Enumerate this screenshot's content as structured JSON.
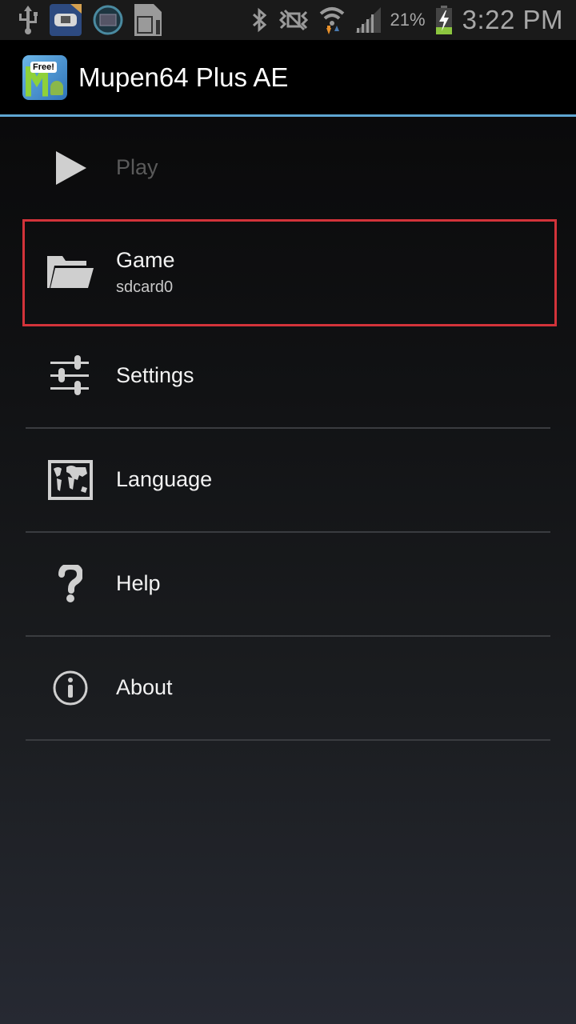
{
  "status_bar": {
    "left_icons": [
      "usb-icon",
      "gba-emulator-app-icon",
      "circle-app-icon",
      "sd-card-icon"
    ],
    "right_icons": [
      "bluetooth-icon",
      "vibrate-mute-icon",
      "wifi-icon",
      "signal-icon"
    ],
    "battery_percent": "21%",
    "battery_charging": true,
    "time": "3:22 PM"
  },
  "action_bar": {
    "app_icon": "mupen64-app-icon",
    "app_icon_badge": "Free!",
    "title": "Mupen64 Plus AE",
    "accent_color": "#5ea6d2"
  },
  "menu": {
    "items": [
      {
        "id": "play",
        "label": "Play",
        "icon": "play-icon",
        "enabled": false
      },
      {
        "id": "game",
        "label": "Game",
        "subtitle": "sdcard0",
        "icon": "folder-icon",
        "enabled": true,
        "highlighted": true
      },
      {
        "id": "settings",
        "label": "Settings",
        "icon": "sliders-icon",
        "enabled": true
      },
      {
        "id": "language",
        "label": "Language",
        "icon": "world-map-icon",
        "enabled": true
      },
      {
        "id": "help",
        "label": "Help",
        "icon": "question-icon",
        "enabled": true
      },
      {
        "id": "about",
        "label": "About",
        "icon": "info-icon",
        "enabled": true
      }
    ],
    "highlight_color": "#d2333a"
  }
}
